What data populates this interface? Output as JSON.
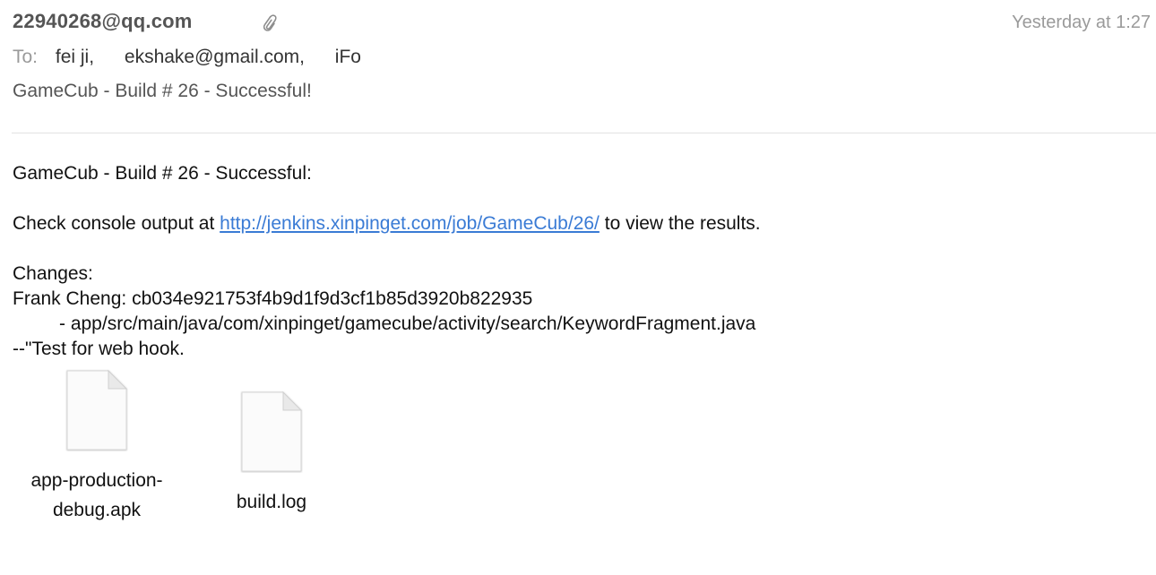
{
  "header": {
    "sender": "22940268@qq.com",
    "date": "Yesterday at 1:27",
    "to_label": "To:",
    "recipients": [
      "fei ji,",
      "ekshake@gmail.com,",
      "iFo"
    ],
    "subject": "GameCub - Build # 26 - Successful!",
    "attachment_icon": "paperclip-icon"
  },
  "body": {
    "title": "GameCub - Build # 26 - Successful:",
    "check_prefix": "Check console output at",
    "console_url": "http://jenkins.xinpinget.com/job/GameCub/26/",
    "check_suffix": "to view the results.",
    "changes_label": "Changes:",
    "commit_line": "Frank Cheng: cb034e921753f4b9d1f9d3cf1b85d3920b822935",
    "changed_file": "- app/src/main/java/com/xinpinget/gamecube/activity/search/KeywordFragment.java",
    "commit_message": "--\"Test for web hook."
  },
  "attachments": [
    {
      "name_line1": "app-production-",
      "name_line2": "debug.apk",
      "icon": "document-icon"
    },
    {
      "name_line1": "build.log",
      "icon": "document-icon"
    }
  ]
}
